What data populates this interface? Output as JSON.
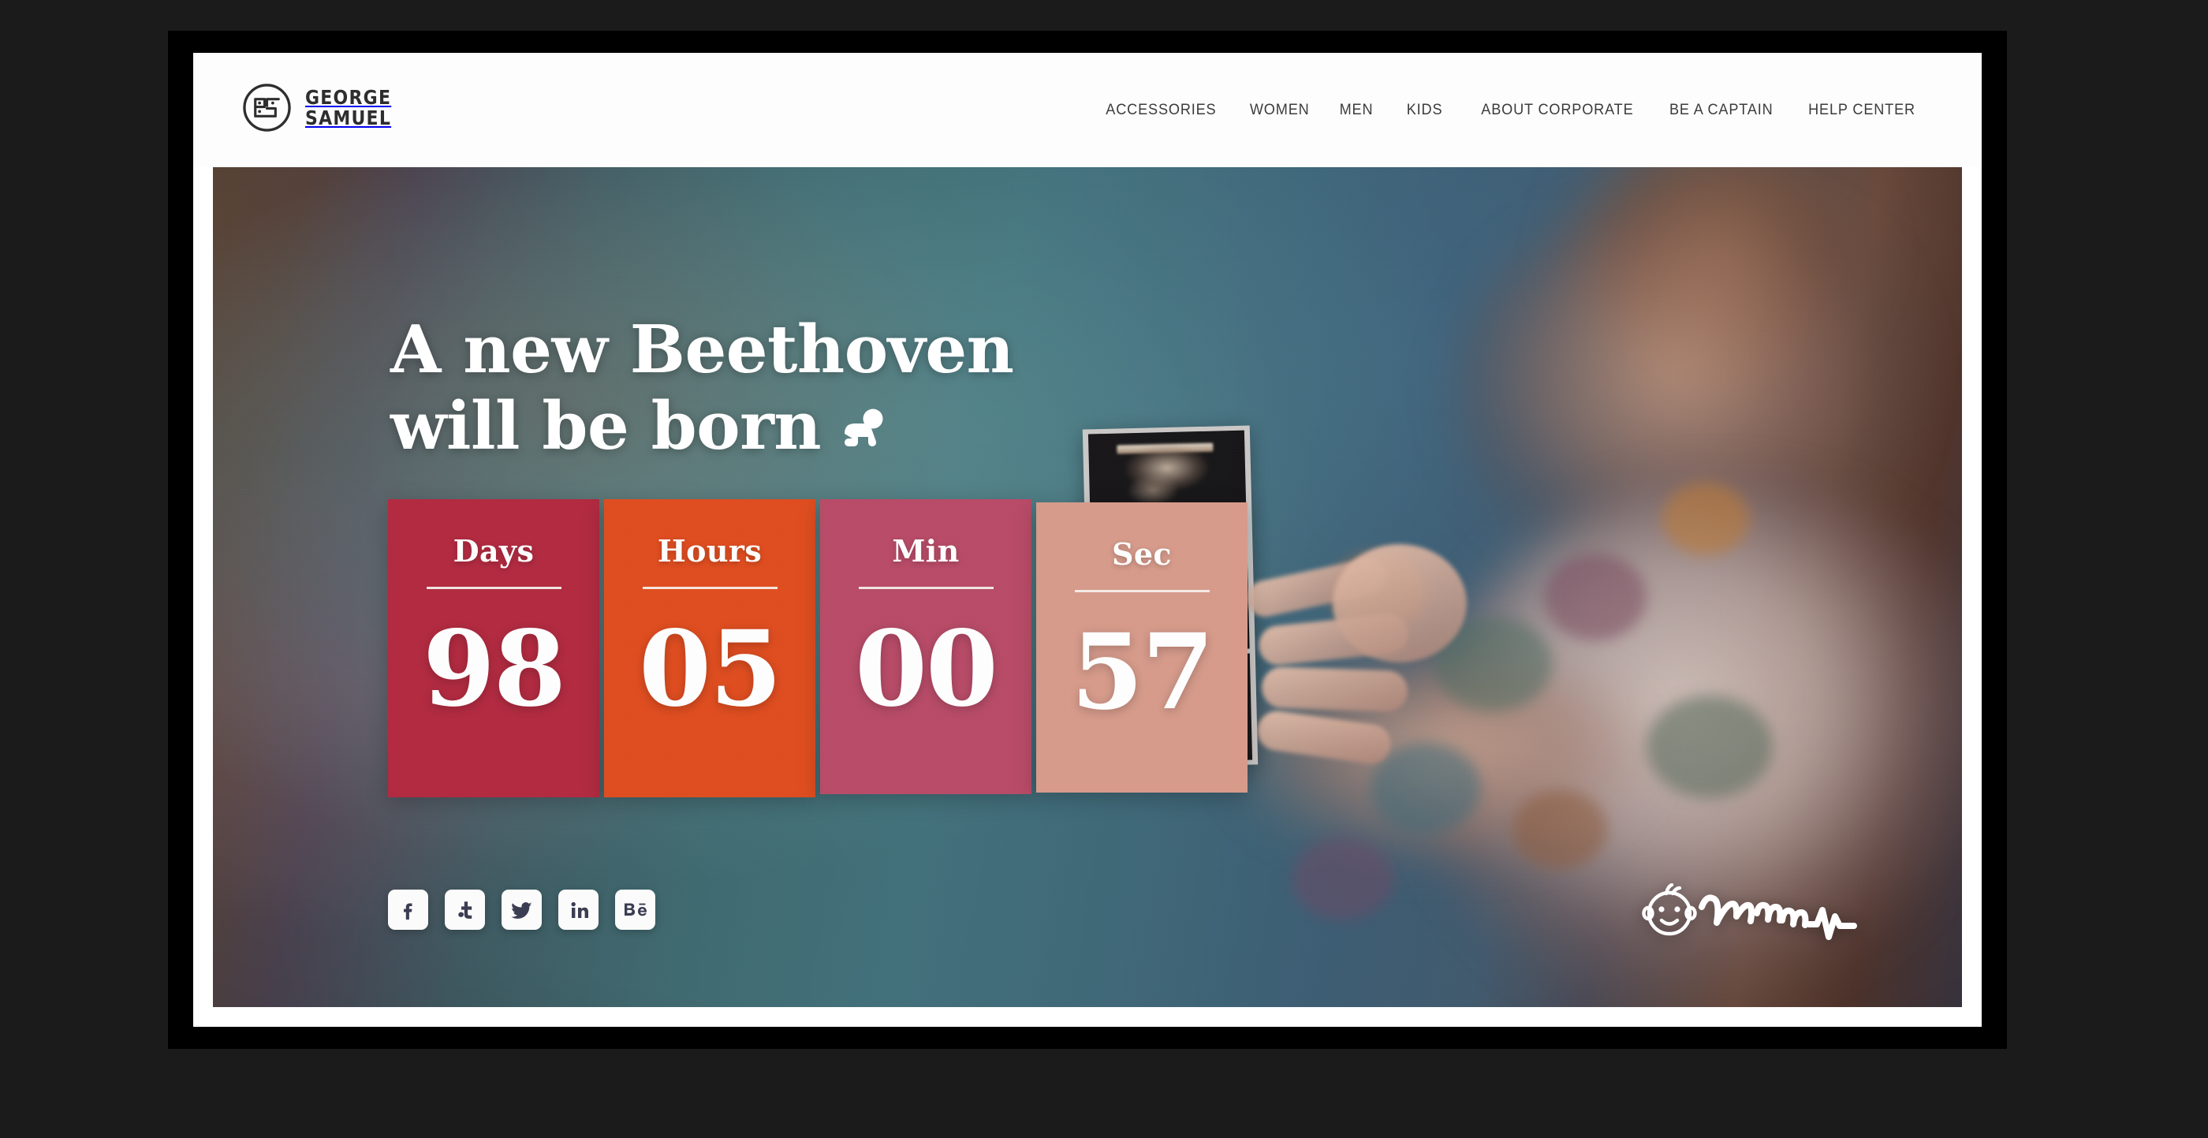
{
  "brand": {
    "name_line1": "GEORGE",
    "name_line2": "SAMUEL",
    "logo_icon": "george-samuel-circle-face-logo"
  },
  "nav": {
    "items": [
      {
        "label": "ACCESSORIES"
      },
      {
        "label": "WOMEN"
      },
      {
        "label": "MEN"
      },
      {
        "label": "KIDS"
      },
      {
        "label": "ABOUT CORPORATE"
      },
      {
        "label": "BE A CAPTAIN"
      },
      {
        "label": "HELP CENTER"
      }
    ]
  },
  "hero": {
    "headline_line1": "A new Beethoven",
    "headline_line2": "will be born",
    "headline_end_icon": "crawling-baby-icon",
    "background_photo": "pregnant-woman-holding-ultrasound-photos"
  },
  "countdown": {
    "units": [
      {
        "label": "Days",
        "value": "98",
        "color": "#b32a40"
      },
      {
        "label": "Hours",
        "value": "05",
        "color": "#e04d1f"
      },
      {
        "label": "Min",
        "value": "00",
        "color": "#b94b68"
      },
      {
        "label": "Sec",
        "value": "57",
        "color": "#d79b8b"
      }
    ]
  },
  "social": {
    "items": [
      {
        "icon": "facebook-icon",
        "name": "Facebook"
      },
      {
        "icon": "twitter-t-icon",
        "name": "Twitter"
      },
      {
        "icon": "twitter-bird-icon",
        "name": "Twitter"
      },
      {
        "icon": "linkedin-icon",
        "name": "LinkedIn"
      },
      {
        "icon": "behance-icon",
        "name": "Behance"
      }
    ]
  },
  "product_logo": {
    "wordmark": "Waaaa",
    "icon": "baby-face-heartbeat-logo"
  },
  "colors": {
    "page_background": "#1b1b1b",
    "frame": "#000000",
    "header_background": "#fdfdfd",
    "nav_text": "#3c3c3c",
    "headline_text": "#ffffff"
  }
}
